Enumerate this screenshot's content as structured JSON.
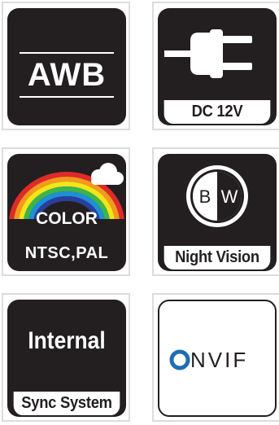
{
  "tiles": {
    "awb": {
      "text": "AWB",
      "icon": "awb-icon"
    },
    "dc": {
      "label": "DC 12V",
      "icon": "power-plug-icon"
    },
    "color": {
      "title": "COLOR",
      "standards": "NTSC,PAL",
      "icon": "rainbow-cloud-icon"
    },
    "night": {
      "badge_left": "B",
      "badge_right": "W",
      "label": "Night Vision",
      "icon": "black-white-badge-icon"
    },
    "sync": {
      "title": "Internal",
      "label": "Sync System"
    },
    "onvif": {
      "logo_text": "ONVIF",
      "icon": "onvif-logo"
    }
  },
  "colors": {
    "tile_dark": "#231f20",
    "onvif_blue": "#1e6db5",
    "rainbow": [
      "#e02a2a",
      "#f39a1e",
      "#f3e51a",
      "#3bb54a",
      "#1f8fd6",
      "#2a3f9c"
    ]
  }
}
